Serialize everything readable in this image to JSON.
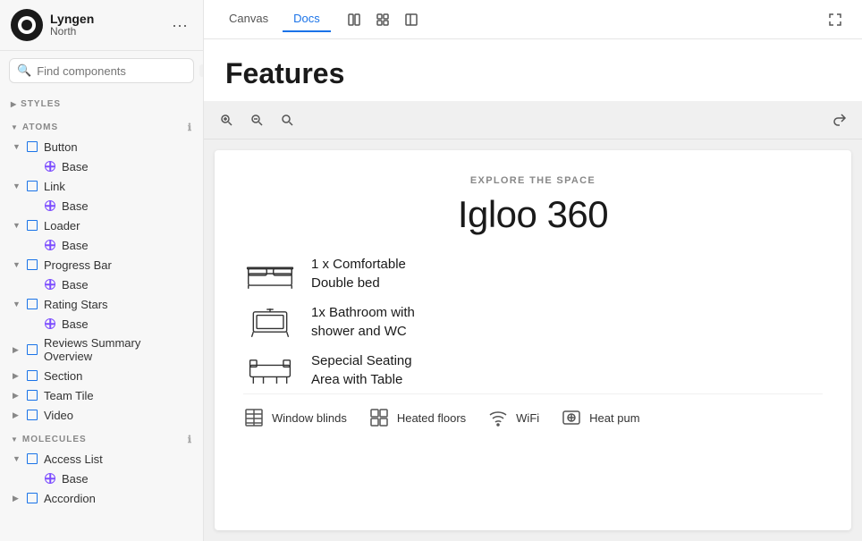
{
  "sidebar": {
    "logo": {
      "name1": "Lyngen",
      "name2": "North"
    },
    "search": {
      "placeholder": "Find components",
      "shortcut": "/"
    },
    "sections": [
      {
        "id": "styles",
        "label": "STYLES"
      },
      {
        "id": "atoms",
        "label": "ATOMS"
      },
      {
        "id": "molecules",
        "label": "MOLECULES"
      }
    ],
    "atoms_items": [
      {
        "id": "button",
        "label": "Button",
        "level": 1,
        "expanded": true
      },
      {
        "id": "button-base",
        "label": "Base",
        "level": 2
      },
      {
        "id": "link",
        "label": "Link",
        "level": 1,
        "expanded": true
      },
      {
        "id": "link-base",
        "label": "Base",
        "level": 2
      },
      {
        "id": "loader",
        "label": "Loader",
        "level": 1,
        "expanded": true
      },
      {
        "id": "loader-base",
        "label": "Base",
        "level": 2
      },
      {
        "id": "progress-bar",
        "label": "Progress Bar",
        "level": 1,
        "expanded": true
      },
      {
        "id": "progress-bar-base",
        "label": "Base",
        "level": 2
      },
      {
        "id": "rating-stars",
        "label": "Rating Stars",
        "level": 1,
        "expanded": true
      },
      {
        "id": "rating-stars-base",
        "label": "Base",
        "level": 2
      },
      {
        "id": "reviews-summary",
        "label": "Reviews Summary Overview",
        "level": 1
      },
      {
        "id": "section",
        "label": "Section",
        "level": 1
      },
      {
        "id": "team-tile",
        "label": "Team Tile",
        "level": 1
      },
      {
        "id": "video",
        "label": "Video",
        "level": 1
      }
    ],
    "molecules_items": [
      {
        "id": "access-list",
        "label": "Access List",
        "level": 1,
        "expanded": true
      },
      {
        "id": "access-list-base",
        "label": "Base",
        "level": 2
      },
      {
        "id": "accordion",
        "label": "Accordion",
        "level": 1
      }
    ]
  },
  "topbar": {
    "tabs": [
      {
        "id": "canvas",
        "label": "Canvas"
      },
      {
        "id": "docs",
        "label": "Docs",
        "active": true
      }
    ]
  },
  "main": {
    "page_title": "Features",
    "canvas": {
      "explore_label": "EXPLORE THE SPACE",
      "product_title": "Igloo 360",
      "features": [
        {
          "id": "bed",
          "text_line1": "1 x Comfortable",
          "text_line2": "Double bed"
        },
        {
          "id": "bathroom",
          "text_line1": "1x Bathroom with",
          "text_line2": "shower and WC"
        },
        {
          "id": "seating",
          "text_line1": "Sepecial Seating",
          "text_line2": "Area with Table"
        }
      ],
      "amenities": [
        {
          "id": "window-blinds",
          "icon": "blinds",
          "label": "Window blinds"
        },
        {
          "id": "heated-floors",
          "icon": "grid",
          "label": "Heated floors"
        },
        {
          "id": "wifi",
          "icon": "wifi",
          "label": "WiFi"
        },
        {
          "id": "heat-pump",
          "icon": "heatpump",
          "label": "Heat pum"
        }
      ]
    }
  }
}
